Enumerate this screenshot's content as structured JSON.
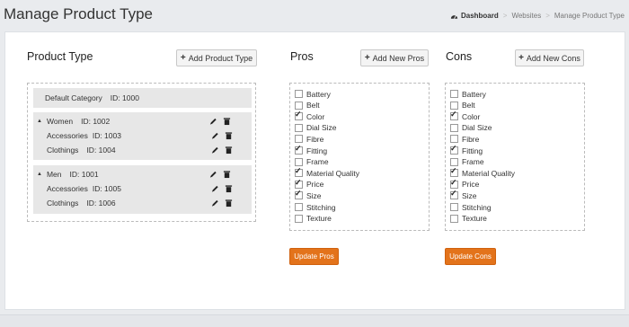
{
  "page": {
    "title": "Manage Product Type"
  },
  "breadcrumb": {
    "home": "Dashboard",
    "items": [
      "Websites",
      "Manage Product Type"
    ]
  },
  "product_type": {
    "heading": "Product Type",
    "add_button": "Add Product Type",
    "default_category": {
      "name": "Default Category",
      "id_label": "ID: 1000"
    },
    "groups": [
      {
        "name": "Women",
        "id_label": "ID: 1002",
        "children": [
          {
            "name": "Accessories",
            "id_label": "ID: 1003"
          },
          {
            "name": "Clothings",
            "id_label": "ID: 1004"
          }
        ]
      },
      {
        "name": "Men",
        "id_label": "ID: 1001",
        "children": [
          {
            "name": "Accessories",
            "id_label": "ID: 1005"
          },
          {
            "name": "Clothings",
            "id_label": "ID: 1006"
          }
        ]
      }
    ]
  },
  "pros": {
    "heading": "Pros",
    "add_button": "Add New Pros",
    "update_button": "Update Pros",
    "options": [
      {
        "label": "Battery",
        "checked": false
      },
      {
        "label": "Belt",
        "checked": false
      },
      {
        "label": "Color",
        "checked": true
      },
      {
        "label": "Dial Size",
        "checked": false
      },
      {
        "label": "Fibre",
        "checked": false
      },
      {
        "label": "Fitting",
        "checked": true
      },
      {
        "label": "Frame",
        "checked": false
      },
      {
        "label": "Material Quality",
        "checked": true
      },
      {
        "label": "Price",
        "checked": true
      },
      {
        "label": "Size",
        "checked": true
      },
      {
        "label": "Stitching",
        "checked": false
      },
      {
        "label": "Texture",
        "checked": false
      }
    ]
  },
  "cons": {
    "heading": "Cons",
    "add_button": "Add New Cons",
    "update_button": "Update Cons",
    "options": [
      {
        "label": "Battery",
        "checked": false
      },
      {
        "label": "Belt",
        "checked": false
      },
      {
        "label": "Color",
        "checked": true
      },
      {
        "label": "Dial Size",
        "checked": false
      },
      {
        "label": "Fibre",
        "checked": false
      },
      {
        "label": "Fitting",
        "checked": true
      },
      {
        "label": "Frame",
        "checked": false
      },
      {
        "label": "Material Quality",
        "checked": true
      },
      {
        "label": "Price",
        "checked": true
      },
      {
        "label": "Size",
        "checked": true
      },
      {
        "label": "Stitching",
        "checked": false
      },
      {
        "label": "Texture",
        "checked": false
      }
    ]
  },
  "colors": {
    "accent": "#e3731b",
    "panel_bg": "#ffffff",
    "page_bg": "#e9ebee",
    "tree_row_bg": "#e7e7e7"
  }
}
